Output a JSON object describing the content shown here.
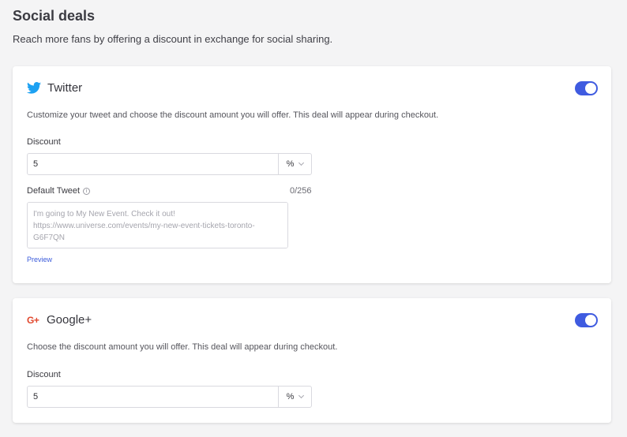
{
  "header": {
    "title": "Social deals",
    "subtitle": "Reach more fans by offering a discount in exchange for social sharing."
  },
  "twitter": {
    "icon": "twitter-bird-icon",
    "title": "Twitter",
    "enabled": true,
    "description": "Customize your tweet and choose the discount amount you will offer. This deal will appear during checkout.",
    "discount_label": "Discount",
    "discount_value": "5",
    "discount_unit": "%",
    "tweet_label": "Default Tweet",
    "tweet_counter": "0/256",
    "tweet_placeholder": "I'm going to My New Event. Check it out! https://www.universe.com/events/my-new-event-tickets-toronto-G6F7QN",
    "preview_label": "Preview"
  },
  "google": {
    "icon": "google-plus-icon",
    "title": "Google+",
    "enabled": true,
    "description": "Choose the discount amount you will offer. This deal will appear during checkout.",
    "discount_label": "Discount",
    "discount_value": "5",
    "discount_unit": "%"
  },
  "colors": {
    "accent": "#3f5be0",
    "twitter_blue": "#1da1f2",
    "google_red": "#e0472d",
    "background": "#f4f4f5"
  }
}
